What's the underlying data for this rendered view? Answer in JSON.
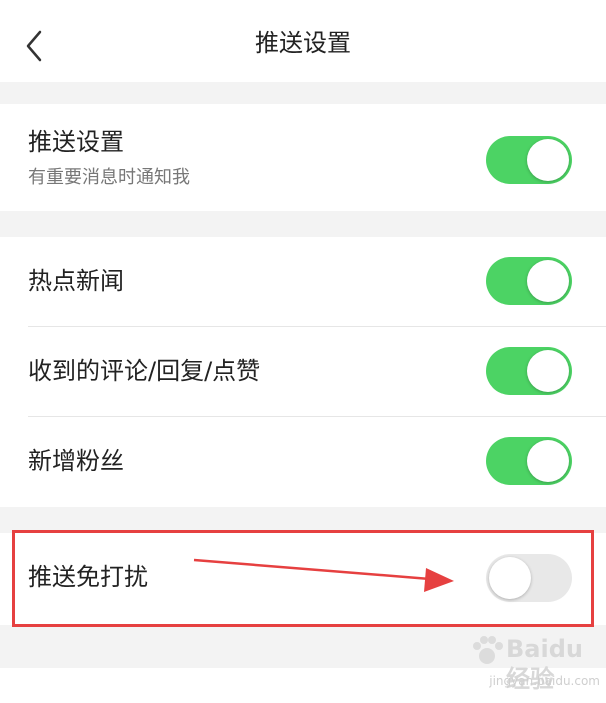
{
  "header": {
    "title": "推送设置",
    "back_icon": "chevron-left-icon"
  },
  "sections": [
    {
      "items": [
        {
          "label": "推送设置",
          "sub": "有重要消息时通知我",
          "enabled": true
        }
      ]
    },
    {
      "items": [
        {
          "label": "热点新闻",
          "enabled": true
        },
        {
          "label": "收到的评论/回复/点赞",
          "enabled": true
        },
        {
          "label": "新增粉丝",
          "enabled": true
        }
      ]
    },
    {
      "items": [
        {
          "label": "推送免打扰",
          "enabled": false
        }
      ]
    }
  ],
  "colors": {
    "toggle_on": "#4cd364",
    "toggle_off": "#e8e8e8",
    "annotation": "#e64040"
  },
  "watermark": {
    "brand": "Baidu经验",
    "url": "jingyan.baidu.com"
  }
}
